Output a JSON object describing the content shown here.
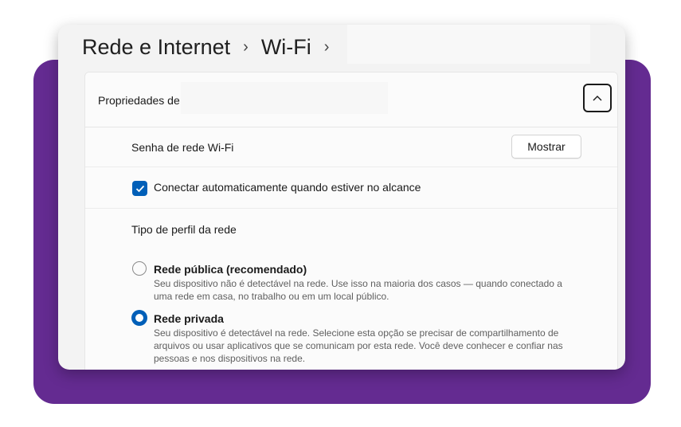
{
  "breadcrumb": {
    "parent": "Rede e Internet",
    "current": "Wi-Fi",
    "separator": "›"
  },
  "properties": {
    "header_label": "Propriedades de",
    "collapse_icon": "chevron-up-icon"
  },
  "password": {
    "label": "Senha de rede Wi-Fi",
    "show_button": "Mostrar"
  },
  "auto_connect": {
    "label": "Conectar automaticamente quando estiver no alcance",
    "checked": true
  },
  "profile": {
    "heading": "Tipo de perfil da rede",
    "options": [
      {
        "title": "Rede pública (recomendado)",
        "description": "Seu dispositivo não é detectável na rede. Use isso na maioria dos casos — quando conectado a uma rede em casa, no trabalho ou em um local público.",
        "selected": false
      },
      {
        "title": "Rede privada",
        "description": "Seu dispositivo é detectável na rede. Selecione esta opção se precisar de compartilhamento de arquivos ou usar aplicativos que se comunicam por esta rede. Você deve conhecer e confiar nas pessoas e nos dispositivos na rede.",
        "selected": true
      }
    ]
  },
  "colors": {
    "accent": "#005fb8",
    "frame": "#642b91"
  }
}
